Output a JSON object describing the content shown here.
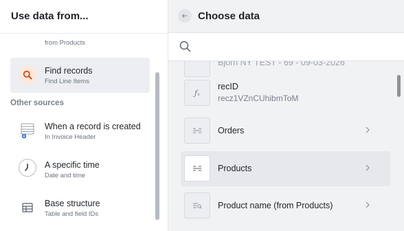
{
  "left_panel": {
    "title": "Use data from...",
    "partial_item": {
      "subtitle": "from Products"
    },
    "items": [
      {
        "title": "Find records",
        "subtitle": "Find Line Items",
        "icon": "search-icon",
        "selected": true
      }
    ],
    "other_sources_label": "Other sources",
    "other_items": [
      {
        "title": "When a record is created",
        "subtitle": "In Invoice Header",
        "icon": "record-created-icon"
      },
      {
        "title": "A specific time",
        "subtitle": "Date and time",
        "icon": "clock-icon"
      },
      {
        "title": "Base structure",
        "subtitle": "Table and field IDs",
        "icon": "table-icon"
      }
    ]
  },
  "right_panel": {
    "title": "Choose data",
    "search": {
      "placeholder": "",
      "value": ""
    },
    "partial_row": {
      "label": "Bjorn NY TEST - 69 - 09-03-2026"
    },
    "rows": [
      {
        "label": "recID",
        "value": "recz1VZnCUhibmToM",
        "icon": "formula-icon",
        "has_chevron": false
      },
      {
        "label": "Orders",
        "icon": "linked-record-icon",
        "has_chevron": true
      },
      {
        "label": "Products",
        "icon": "linked-record-icon",
        "has_chevron": true,
        "highlighted": true
      },
      {
        "label": "Product name (from Products)",
        "icon": "lookup-icon",
        "has_chevron": true
      }
    ]
  },
  "colors": {
    "accent_orange": "#d9480f",
    "selected_bg": "#eceef1",
    "panel_bg": "#f1f2f4"
  }
}
